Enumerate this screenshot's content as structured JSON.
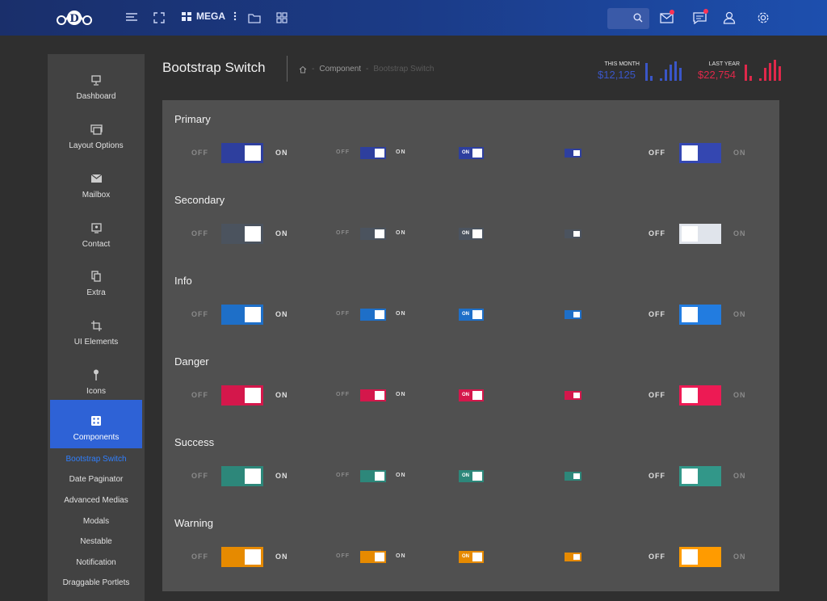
{
  "topbar": {
    "logo_letter": "D",
    "mega_label": "MEGA",
    "icons": [
      "menu-lines-icon",
      "fullscreen-icon",
      "mega-grid-icon",
      "kebab-icon",
      "folder-icon",
      "apps-grid-icon",
      "search-icon",
      "mail-icon",
      "chat-icon",
      "user-icon",
      "gear-icon"
    ]
  },
  "sidebar": {
    "items": [
      {
        "label": "Dashboard",
        "icon": "monitor-icon"
      },
      {
        "label": "Layout Options",
        "icon": "layout-icon"
      },
      {
        "label": "Mailbox",
        "icon": "envelope-icon"
      },
      {
        "label": "Contact",
        "icon": "contact-icon"
      },
      {
        "label": "Extra",
        "icon": "copy-icon"
      },
      {
        "label": "UI Elements",
        "icon": "crop-icon"
      },
      {
        "label": "Icons",
        "icon": "pin-icon"
      },
      {
        "label": "Components",
        "icon": "dice-icon"
      }
    ],
    "subitems": [
      "Bootstrap Switch",
      "Date Paginator",
      "Advanced Medias",
      "Modals",
      "Nestable",
      "Notification",
      "Draggable Portlets"
    ]
  },
  "header": {
    "title": "Bootstrap Switch",
    "breadcrumb": [
      "Component",
      "Bootstrap Switch"
    ],
    "this_month_label": "THIS MONTH",
    "this_month_value": "$12,125",
    "last_year_label": "LAST YEAR",
    "last_year_value": "$22,754",
    "blue": "#3a56c8",
    "red": "#e0284a"
  },
  "labels": {
    "off": "OFF",
    "on": "ON"
  },
  "sections": [
    {
      "name": "Primary",
      "color": "#2e3f9e"
    },
    {
      "name": "Secondary",
      "color": "#4b535e",
      "light": "#c8ccd2"
    },
    {
      "name": "Info",
      "color": "#1e6fc8"
    },
    {
      "name": "Danger",
      "color": "#d4174b"
    },
    {
      "name": "Success",
      "color": "#2d877a"
    },
    {
      "name": "Warning",
      "color": "#e68a00"
    }
  ]
}
